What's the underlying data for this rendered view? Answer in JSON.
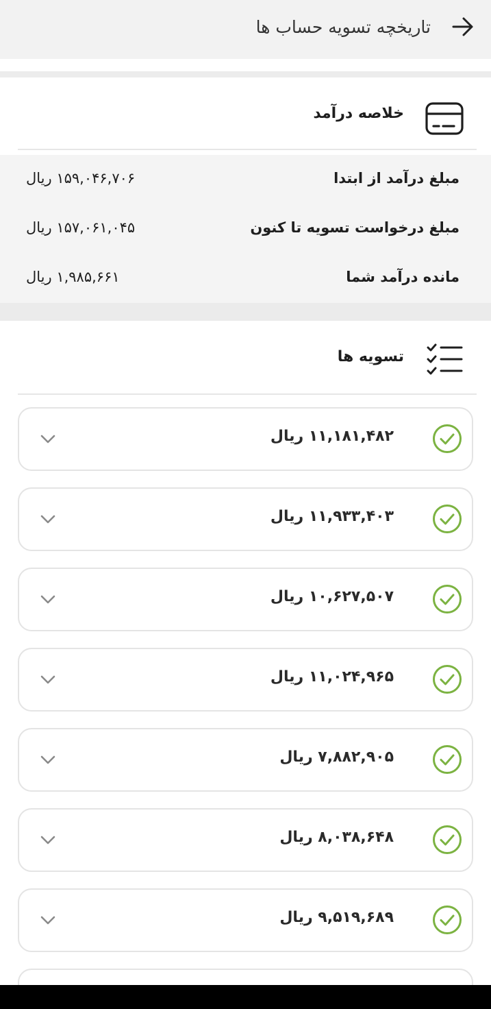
{
  "header": {
    "title": "تاریخچه تسویه حساب ها",
    "back_icon": "arrow-right-icon"
  },
  "summary": {
    "title": "خلاصه درآمد",
    "icon": "credit-card-icon",
    "rows": [
      {
        "label": "مبلغ درآمد از ابتدا",
        "value": "۱۵۹,۰۴۶,۷۰۶ ریال"
      },
      {
        "label": "مبلغ درخواست تسویه تا کنون",
        "value": "۱۵۷,۰۶۱,۰۴۵ ریال"
      },
      {
        "label": "مانده درآمد شما",
        "value": "۱,۹۸۵,۶۶۱ ریال"
      }
    ]
  },
  "settlements": {
    "title": "تسویه ها",
    "icon": "checklist-icon",
    "status_color": "#7cb342",
    "items": [
      {
        "amount": "۱۱,۱۸۱,۴۸۲ ریال",
        "status": "check-circle-icon"
      },
      {
        "amount": "۱۱,۹۳۳,۴۰۳ ریال",
        "status": "check-circle-icon"
      },
      {
        "amount": "۱۰,۶۲۷,۵۰۷ ریال",
        "status": "check-circle-icon"
      },
      {
        "amount": "۱۱,۰۲۴,۹۶۵ ریال",
        "status": "check-circle-icon"
      },
      {
        "amount": "۷,۸۸۲,۹۰۵ ریال",
        "status": "check-circle-icon"
      },
      {
        "amount": "۸,۰۳۸,۶۴۸ ریال",
        "status": "check-circle-icon"
      },
      {
        "amount": "۹,۵۱۹,۶۸۹ ریال",
        "status": "check-circle-icon"
      },
      {
        "amount": "",
        "status": ""
      }
    ]
  }
}
